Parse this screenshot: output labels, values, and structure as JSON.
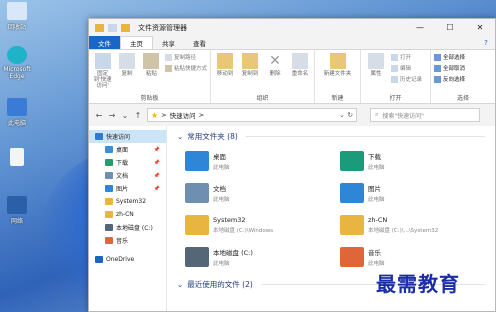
{
  "desktop": {
    "icons": [
      {
        "label": "回收站",
        "icon": "recycle-bin-icon",
        "color": "#d9e8f8"
      },
      {
        "label": "Microsoft Edge",
        "icon": "edge-icon",
        "color": "#1fb3c9"
      },
      {
        "label": "此电脑",
        "icon": "computer-icon",
        "color": "#3a7bd5"
      },
      {
        "label": "",
        "icon": "document-icon",
        "color": "#f4f4f4"
      },
      {
        "label": "网络",
        "icon": "network-icon",
        "color": "#2b5fa8"
      }
    ]
  },
  "window": {
    "title": "文件资源管理器",
    "controls": {
      "minimize": "—",
      "maximize": "☐",
      "close": "✕"
    },
    "tabs": [
      {
        "label": "文件",
        "kind": "file"
      },
      {
        "label": "主页",
        "kind": "active"
      },
      {
        "label": "共享",
        "kind": ""
      },
      {
        "label": "查看",
        "kind": ""
      }
    ],
    "help": "?",
    "ribbon": {
      "clipboard": {
        "label": "剪贴板",
        "pin": "固定到'快速访问'",
        "copy": "复制",
        "paste": "粘贴",
        "copy_path": "复制路径",
        "paste_shortcut": "粘贴快捷方式"
      },
      "organize": {
        "label": "组织",
        "move_to": "移动到",
        "copy_to": "复制到",
        "delete": "删除",
        "rename": "重命名"
      },
      "new": {
        "label": "新建",
        "new_folder": "新建文件夹"
      },
      "open": {
        "label": "打开",
        "properties": "属性",
        "open": "打开",
        "edit": "编辑",
        "history": "历史记录"
      },
      "select": {
        "label": "选择",
        "select_all": "全部选择",
        "select_none": "全部取消",
        "invert": "反向选择"
      }
    },
    "address": {
      "path": "快速访问",
      "separator": ">",
      "search_placeholder": "搜索\"快速访问\""
    },
    "nav_pane": [
      {
        "label": "快速访问",
        "color": "#2f7ad6",
        "pin": "",
        "sel": true,
        "ind": false
      },
      {
        "label": "桌面",
        "color": "#3b8ed8",
        "pin": "📌",
        "sel": false,
        "ind": true
      },
      {
        "label": "下载",
        "color": "#2a9b6b",
        "pin": "📌",
        "sel": false,
        "ind": true
      },
      {
        "label": "文档",
        "color": "#6f8fb0",
        "pin": "📌",
        "sel": false,
        "ind": true
      },
      {
        "label": "图片",
        "color": "#2f86d6",
        "pin": "📌",
        "sel": false,
        "ind": true
      },
      {
        "label": "System32",
        "color": "#e8b640",
        "pin": "",
        "sel": false,
        "ind": true
      },
      {
        "label": "zh-CN",
        "color": "#e8b640",
        "pin": "",
        "sel": false,
        "ind": true
      },
      {
        "label": "本地磁盘 (C:)",
        "color": "#556677",
        "pin": "",
        "sel": false,
        "ind": true
      },
      {
        "label": "音乐",
        "color": "#e0663a",
        "pin": "",
        "sel": false,
        "ind": true
      },
      {
        "label": "OneDrive",
        "color": "#1a66c8",
        "pin": "",
        "sel": false,
        "ind": false
      }
    ],
    "frequent": {
      "header": "常用文件夹 (8)",
      "items": [
        {
          "name": "桌面",
          "sub": "此电脑",
          "color": "#2f86d6"
        },
        {
          "name": "下载",
          "sub": "此电脑",
          "color": "#1a9b79"
        },
        {
          "name": "文档",
          "sub": "此电脑",
          "color": "#6f8fb0"
        },
        {
          "name": "图片",
          "sub": "此电脑",
          "color": "#2f86d6"
        },
        {
          "name": "System32",
          "sub": "本地磁盘 (C:)\\Windows",
          "color": "#e8b640"
        },
        {
          "name": "zh-CN",
          "sub": "本地磁盘 (C:)\\...\\System32",
          "color": "#e8b640"
        },
        {
          "name": "本地磁盘 (C:)",
          "sub": "此电脑",
          "color": "#556677"
        },
        {
          "name": "音乐",
          "sub": "此电脑",
          "color": "#e0663a"
        }
      ]
    },
    "recent": {
      "header": "最近使用的文件 (2)"
    }
  },
  "watermark": "最需教育"
}
